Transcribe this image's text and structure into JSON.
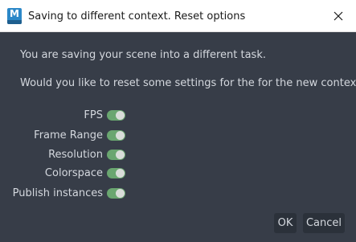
{
  "window": {
    "title": "Saving to different context. Reset options",
    "app_icon_letter": "M"
  },
  "message": {
    "line1": "You are saving your scene into a different task.",
    "line2": "Would you like to reset some settings for the for the new context?"
  },
  "options": [
    {
      "label": "FPS",
      "enabled": true
    },
    {
      "label": "Frame Range",
      "enabled": true
    },
    {
      "label": "Resolution",
      "enabled": true
    },
    {
      "label": "Colorspace",
      "enabled": true
    },
    {
      "label": "Publish instances",
      "enabled": true
    }
  ],
  "buttons": {
    "ok_label": "OK",
    "cancel_label": "Cancel"
  },
  "colors": {
    "background": "#373d48",
    "toggle_on": "#6aa670",
    "button_bg": "#2b313a",
    "app_icon": "#2c88c8"
  },
  "icons": {
    "app": "maya-app-icon",
    "close": "close-icon"
  }
}
